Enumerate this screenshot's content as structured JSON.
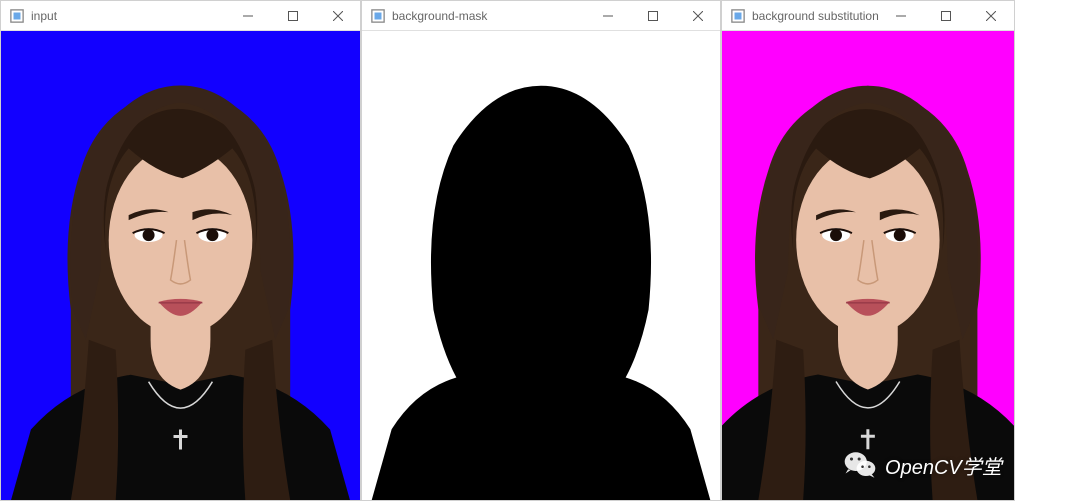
{
  "windows": [
    {
      "title": "input",
      "bg_color": "#1200ff"
    },
    {
      "title": "background-mask",
      "bg_color": "#ffffff"
    },
    {
      "title": "background substitution",
      "bg_color": "#ff00ff"
    }
  ],
  "colors": {
    "skin": "#e8c0a8",
    "hair_dark": "#201410",
    "hair_mid": "#4a2f1e",
    "shirt": "#0a0a0a",
    "lip": "#b8505a",
    "necklace": "#d8d8d8"
  },
  "watermark": {
    "text": "OpenCV学堂",
    "icon": "wechat-icon"
  }
}
